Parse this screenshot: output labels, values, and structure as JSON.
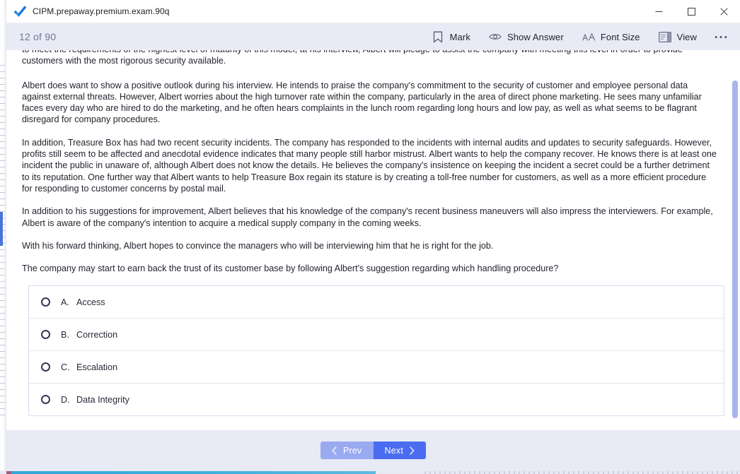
{
  "window": {
    "title": "CIPM.prepaway.premium.exam.90q",
    "logo_icon": "blue-check-logo-icon",
    "controls": [
      {
        "name": "minimize-button",
        "icon": "minimize-icon"
      },
      {
        "name": "maximize-button",
        "icon": "maximize-icon"
      },
      {
        "name": "close-button",
        "icon": "close-icon"
      }
    ]
  },
  "toolbar": {
    "counter": "12 of 90",
    "actions": [
      {
        "label": "Mark",
        "icon": "bookmark-icon",
        "name": "mark-button"
      },
      {
        "label": "Show Answer",
        "icon": "eye-icon",
        "name": "show-answer-button"
      },
      {
        "label": "Font Size",
        "icon": "font-size-icon",
        "name": "font-size-button"
      },
      {
        "label": "View",
        "icon": "view-layout-icon",
        "name": "view-button"
      }
    ],
    "overflow_label": "•••"
  },
  "question": {
    "paragraphs": [
      "to meet the requirements of the highest level of maturity of this model, at his interview, Albert will pledge to assist the company with meeting this level in order to provide customers with the most rigorous security available.",
      "Albert does want to show a positive outlook during his interview. He intends to praise the company's commitment to the security of customer and employee personal data against external threats. However, Albert worries about the high turnover rate within the company, particularly in the area of direct phone marketing. He sees many unfamiliar faces every day who are hired to do the marketing, and he often hears complaints in the lunch room regarding long hours and low pay, as well as what seems to be flagrant disregard for company procedures.",
      "In addition, Treasure Box has had two recent security incidents. The company has responded to the incidents with internal audits and updates to security safeguards. However, profits still seem to be affected and anecdotal evidence indicates that many people still harbor mistrust. Albert wants to help the company recover. He knows there is at least one incident the public in unaware of, although Albert does not know the details. He believes the company's insistence on keeping the incident a secret could be a further detriment to its reputation. One further way that Albert wants to help Treasure Box regain its stature is by creating a toll-free number for customers, as well as a more efficient procedure for responding to customer concerns by postal mail.",
      "In addition to his suggestions for improvement, Albert believes that his knowledge of the company's recent business maneuvers will also impress the interviewers. For example, Albert is aware of the company's intention to acquire a medical supply company in the coming weeks.",
      "With his forward thinking, Albert hopes to convince the managers who will be interviewing him that he is right for the job.",
      "The company may start to earn back the trust of its customer base by following Albert's suggestion regarding which handling procedure?"
    ],
    "options": [
      {
        "letter": "A.",
        "text": "Access",
        "selected": false
      },
      {
        "letter": "B.",
        "text": "Correction",
        "selected": false
      },
      {
        "letter": "C.",
        "text": "Escalation",
        "selected": false
      },
      {
        "letter": "D.",
        "text": "Data Integrity",
        "selected": false
      }
    ]
  },
  "footer": {
    "prev_label": "Prev",
    "next_label": "Next",
    "prev_icon": "chevron-left-icon",
    "next_icon": "chevron-right-icon"
  },
  "colors": {
    "toolbar_bg": "#e8ebf6",
    "next_button": "#4a6cf0",
    "prev_button": "#9aaaf0",
    "scrollbar_thumb": "#a8b4ec",
    "option_border": "#d9dced"
  }
}
